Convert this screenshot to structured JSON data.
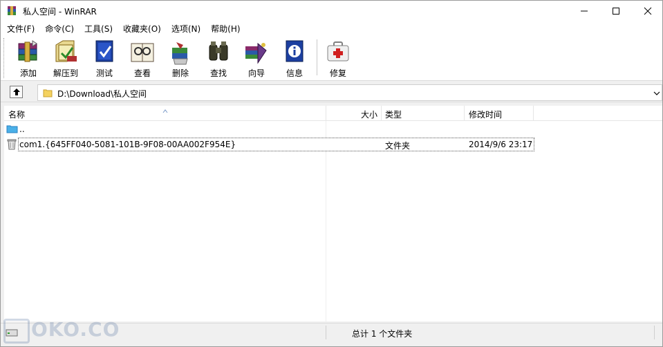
{
  "window": {
    "title": "私人空间 - WinRAR"
  },
  "menu": [
    {
      "label": "文件(F)"
    },
    {
      "label": "命令(C)"
    },
    {
      "label": "工具(S)"
    },
    {
      "label": "收藏夹(O)"
    },
    {
      "label": "选项(N)"
    },
    {
      "label": "帮助(H)"
    }
  ],
  "toolbar": [
    {
      "label": "添加",
      "icon": "add-books-icon"
    },
    {
      "label": "解压到",
      "icon": "extract-to-icon"
    },
    {
      "label": "测试",
      "icon": "test-icon"
    },
    {
      "label": "查看",
      "icon": "view-icon"
    },
    {
      "label": "删除",
      "icon": "delete-icon"
    },
    {
      "label": "查找",
      "icon": "find-icon"
    },
    {
      "label": "向导",
      "icon": "wizard-icon"
    },
    {
      "label": "信息",
      "icon": "info-icon"
    },
    {
      "label": "修复",
      "icon": "repair-icon"
    }
  ],
  "address": {
    "path": "D:\\Download\\私人空间"
  },
  "columns": [
    {
      "label": "名称"
    },
    {
      "label": "大小"
    },
    {
      "label": "类型"
    },
    {
      "label": "修改时间"
    }
  ],
  "rows": [
    {
      "name": "..",
      "size": "",
      "type": "",
      "modified": "",
      "icon": "parent-folder-icon"
    },
    {
      "name": "com1.{645FF040-5081-101B-9F08-00AA002F954E}",
      "size": "",
      "type": "文件夹",
      "modified": "2014/9/6 23:17",
      "icon": "recycle-bin-icon"
    }
  ],
  "status": {
    "summary": "总计 1 个文件夹"
  },
  "watermark": "OKO.CO"
}
